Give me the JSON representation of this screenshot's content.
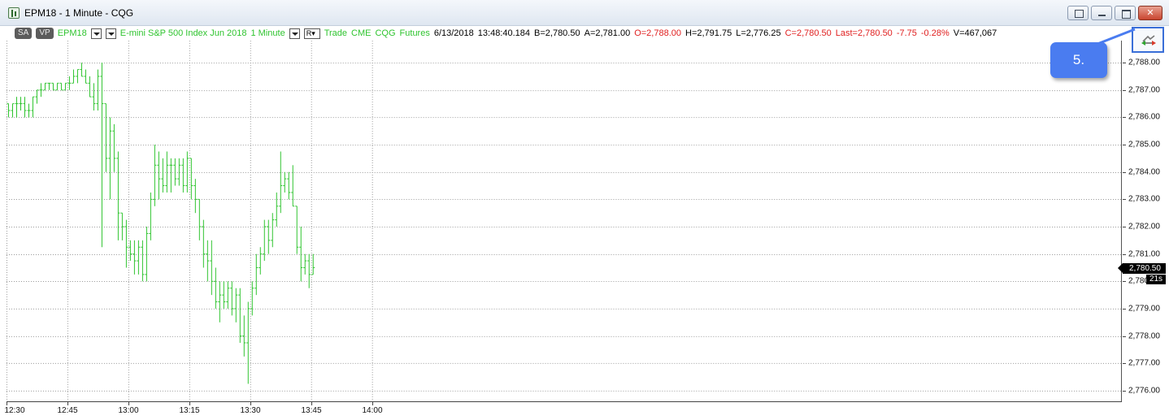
{
  "window": {
    "title": "EPM18 - 1 Minute - CQG",
    "buttons": [
      "layout-icon",
      "minimize-icon",
      "maximize-icon",
      "close-icon"
    ]
  },
  "info_bar": {
    "sa_button": "SA",
    "vp_button": "VP",
    "symbol": "EPM18",
    "instrument": "E-mini S&P 500 Index Jun 2018",
    "interval": "1 Minute",
    "r_button": "R",
    "trade": "Trade",
    "exchange": "CME",
    "data_source": "CQG",
    "type": "Futures",
    "date": "6/13/2018",
    "time": "13:48:40.184",
    "bid": "B=2,780.50",
    "ask": "A=2,781.00",
    "open": "O=2,788.00",
    "high": "H=2,791.75",
    "low": "L=2,776.25",
    "close": "C=2,780.50",
    "last": "Last=2,780.50",
    "net_change": "-7.75",
    "pct_change": "-0.28%",
    "volume": "V=467,067"
  },
  "callout": {
    "label": "5."
  },
  "price_flag": {
    "price": "2,780.50",
    "countdown": "21s"
  },
  "colors": {
    "bar": "#2fc42f",
    "callout": "#4a7cf0",
    "up_text": "#2fc42f",
    "down_text": "#e02020"
  },
  "chart_data": {
    "type": "ohlc",
    "symbol": "EPM18",
    "x_labels": [
      "12:30",
      "12:45",
      "13:00",
      "13:15",
      "13:30",
      "13:45",
      "14:00"
    ],
    "x_label_minutes": [
      0,
      15,
      30,
      45,
      60,
      75,
      90
    ],
    "y_labels": [
      "2,788.00",
      "2,787.00",
      "2,786.00",
      "2,785.00",
      "2,784.00",
      "2,783.00",
      "2,782.00",
      "2,781.00",
      "2,780.00",
      "2,779.00",
      "2,778.00",
      "2,777.00",
      "2,776.00"
    ],
    "ylim": [
      2775.8,
      2789.0
    ],
    "x_minutes_range": [
      0,
      115
    ],
    "grid": true,
    "bars": [
      {
        "o": 2786.5,
        "h": 2786.5,
        "l": 2786.0,
        "c": 2786.25
      },
      {
        "o": 2786.25,
        "h": 2786.5,
        "l": 2786.0,
        "c": 2786.5
      },
      {
        "o": 2786.5,
        "h": 2786.75,
        "l": 2786.0,
        "c": 2786.5
      },
      {
        "o": 2786.5,
        "h": 2786.75,
        "l": 2786.25,
        "c": 2786.5
      },
      {
        "o": 2786.5,
        "h": 2786.75,
        "l": 2786.0,
        "c": 2786.25
      },
      {
        "o": 2786.25,
        "h": 2786.5,
        "l": 2786.0,
        "c": 2786.25
      },
      {
        "o": 2786.25,
        "h": 2786.75,
        "l": 2786.0,
        "c": 2786.75
      },
      {
        "o": 2786.75,
        "h": 2787.0,
        "l": 2786.5,
        "c": 2787.0
      },
      {
        "o": 2787.0,
        "h": 2787.25,
        "l": 2786.75,
        "c": 2787.0
      },
      {
        "o": 2787.0,
        "h": 2787.25,
        "l": 2787.0,
        "c": 2787.25
      },
      {
        "o": 2787.25,
        "h": 2787.25,
        "l": 2787.0,
        "c": 2787.25
      },
      {
        "o": 2787.25,
        "h": 2787.25,
        "l": 2787.0,
        "c": 2787.0
      },
      {
        "o": 2787.0,
        "h": 2787.25,
        "l": 2787.0,
        "c": 2787.25
      },
      {
        "o": 2787.25,
        "h": 2787.25,
        "l": 2787.0,
        "c": 2787.0
      },
      {
        "o": 2787.0,
        "h": 2787.25,
        "l": 2787.0,
        "c": 2787.25
      },
      {
        "o": 2787.25,
        "h": 2787.5,
        "l": 2787.0,
        "c": 2787.25
      },
      {
        "o": 2787.25,
        "h": 2787.75,
        "l": 2787.25,
        "c": 2787.5
      },
      {
        "o": 2787.5,
        "h": 2787.75,
        "l": 2787.25,
        "c": 2787.75
      },
      {
        "o": 2787.75,
        "h": 2788.0,
        "l": 2787.5,
        "c": 2787.5
      },
      {
        "o": 2787.5,
        "h": 2787.75,
        "l": 2787.25,
        "c": 2787.25
      },
      {
        "o": 2787.25,
        "h": 2787.5,
        "l": 2786.75,
        "c": 2786.75
      },
      {
        "o": 2786.75,
        "h": 2787.25,
        "l": 2786.25,
        "c": 2786.5
      },
      {
        "o": 2786.5,
        "h": 2787.75,
        "l": 2786.25,
        "c": 2787.5
      },
      {
        "o": 2787.5,
        "h": 2788.0,
        "l": 2781.25,
        "c": 2786.5
      },
      {
        "o": 2786.5,
        "h": 2786.5,
        "l": 2784.0,
        "c": 2784.5
      },
      {
        "o": 2784.5,
        "h": 2786.0,
        "l": 2783.0,
        "c": 2785.5
      },
      {
        "o": 2785.5,
        "h": 2785.75,
        "l": 2784.0,
        "c": 2784.5
      },
      {
        "o": 2784.5,
        "h": 2784.75,
        "l": 2781.5,
        "c": 2782.5
      },
      {
        "o": 2782.5,
        "h": 2782.5,
        "l": 2781.5,
        "c": 2782.0
      },
      {
        "o": 2782.0,
        "h": 2782.25,
        "l": 2780.5,
        "c": 2781.25
      },
      {
        "o": 2781.25,
        "h": 2781.5,
        "l": 2780.75,
        "c": 2781.0
      },
      {
        "o": 2781.0,
        "h": 2781.5,
        "l": 2780.25,
        "c": 2780.75
      },
      {
        "o": 2780.75,
        "h": 2781.5,
        "l": 2780.25,
        "c": 2781.25
      },
      {
        "o": 2781.25,
        "h": 2781.5,
        "l": 2780.0,
        "c": 2780.25
      },
      {
        "o": 2780.25,
        "h": 2782.0,
        "l": 2780.0,
        "c": 2781.75
      },
      {
        "o": 2781.75,
        "h": 2783.25,
        "l": 2781.5,
        "c": 2783.0
      },
      {
        "o": 2783.0,
        "h": 2785.0,
        "l": 2782.75,
        "c": 2784.25
      },
      {
        "o": 2784.25,
        "h": 2784.75,
        "l": 2783.0,
        "c": 2783.75
      },
      {
        "o": 2783.75,
        "h": 2784.5,
        "l": 2783.25,
        "c": 2783.5
      },
      {
        "o": 2783.5,
        "h": 2784.75,
        "l": 2783.25,
        "c": 2784.25
      },
      {
        "o": 2784.25,
        "h": 2784.5,
        "l": 2783.25,
        "c": 2784.25
      },
      {
        "o": 2784.25,
        "h": 2784.5,
        "l": 2783.5,
        "c": 2783.75
      },
      {
        "o": 2783.75,
        "h": 2784.5,
        "l": 2783.5,
        "c": 2784.25
      },
      {
        "o": 2784.25,
        "h": 2784.5,
        "l": 2783.25,
        "c": 2783.5
      },
      {
        "o": 2783.5,
        "h": 2784.75,
        "l": 2783.25,
        "c": 2784.5
      },
      {
        "o": 2784.5,
        "h": 2784.5,
        "l": 2783.0,
        "c": 2783.5
      },
      {
        "o": 2783.5,
        "h": 2783.75,
        "l": 2782.5,
        "c": 2783.0
      },
      {
        "o": 2783.0,
        "h": 2783.0,
        "l": 2781.5,
        "c": 2782.0
      },
      {
        "o": 2782.0,
        "h": 2782.25,
        "l": 2780.5,
        "c": 2781.0
      },
      {
        "o": 2781.0,
        "h": 2781.5,
        "l": 2780.0,
        "c": 2780.75
      },
      {
        "o": 2780.75,
        "h": 2781.5,
        "l": 2779.5,
        "c": 2780.0
      },
      {
        "o": 2780.0,
        "h": 2780.5,
        "l": 2779.0,
        "c": 2779.25
      },
      {
        "o": 2779.25,
        "h": 2780.0,
        "l": 2778.5,
        "c": 2779.5
      },
      {
        "o": 2779.5,
        "h": 2780.0,
        "l": 2779.0,
        "c": 2779.25
      },
      {
        "o": 2779.25,
        "h": 2780.0,
        "l": 2779.0,
        "c": 2779.75
      },
      {
        "o": 2779.75,
        "h": 2780.0,
        "l": 2778.75,
        "c": 2779.0
      },
      {
        "o": 2779.0,
        "h": 2779.75,
        "l": 2778.5,
        "c": 2779.5
      },
      {
        "o": 2779.5,
        "h": 2779.75,
        "l": 2777.75,
        "c": 2778.0
      },
      {
        "o": 2778.0,
        "h": 2778.75,
        "l": 2777.25,
        "c": 2777.75
      },
      {
        "o": 2777.75,
        "h": 2779.25,
        "l": 2776.25,
        "c": 2779.0
      },
      {
        "o": 2779.0,
        "h": 2780.0,
        "l": 2778.75,
        "c": 2779.75
      },
      {
        "o": 2779.75,
        "h": 2781.0,
        "l": 2779.5,
        "c": 2780.5
      },
      {
        "o": 2780.5,
        "h": 2781.25,
        "l": 2780.25,
        "c": 2781.0
      },
      {
        "o": 2781.0,
        "h": 2782.25,
        "l": 2780.75,
        "c": 2782.0
      },
      {
        "o": 2782.0,
        "h": 2782.25,
        "l": 2781.0,
        "c": 2781.5
      },
      {
        "o": 2781.5,
        "h": 2782.5,
        "l": 2781.25,
        "c": 2782.25
      },
      {
        "o": 2782.25,
        "h": 2783.25,
        "l": 2782.0,
        "c": 2782.75
      },
      {
        "o": 2782.75,
        "h": 2784.75,
        "l": 2782.5,
        "c": 2783.5
      },
      {
        "o": 2783.5,
        "h": 2784.0,
        "l": 2783.25,
        "c": 2783.75
      },
      {
        "o": 2783.75,
        "h": 2784.0,
        "l": 2783.0,
        "c": 2783.25
      },
      {
        "o": 2783.25,
        "h": 2784.25,
        "l": 2782.75,
        "c": 2782.75
      },
      {
        "o": 2782.75,
        "h": 2782.75,
        "l": 2781.0,
        "c": 2781.25
      },
      {
        "o": 2781.25,
        "h": 2782.0,
        "l": 2780.0,
        "c": 2780.5
      },
      {
        "o": 2780.5,
        "h": 2781.0,
        "l": 2780.25,
        "c": 2780.75
      },
      {
        "o": 2780.75,
        "h": 2781.0,
        "l": 2779.75,
        "c": 2780.25
      },
      {
        "o": 2780.25,
        "h": 2781.0,
        "l": 2780.25,
        "c": 2780.5
      }
    ]
  }
}
